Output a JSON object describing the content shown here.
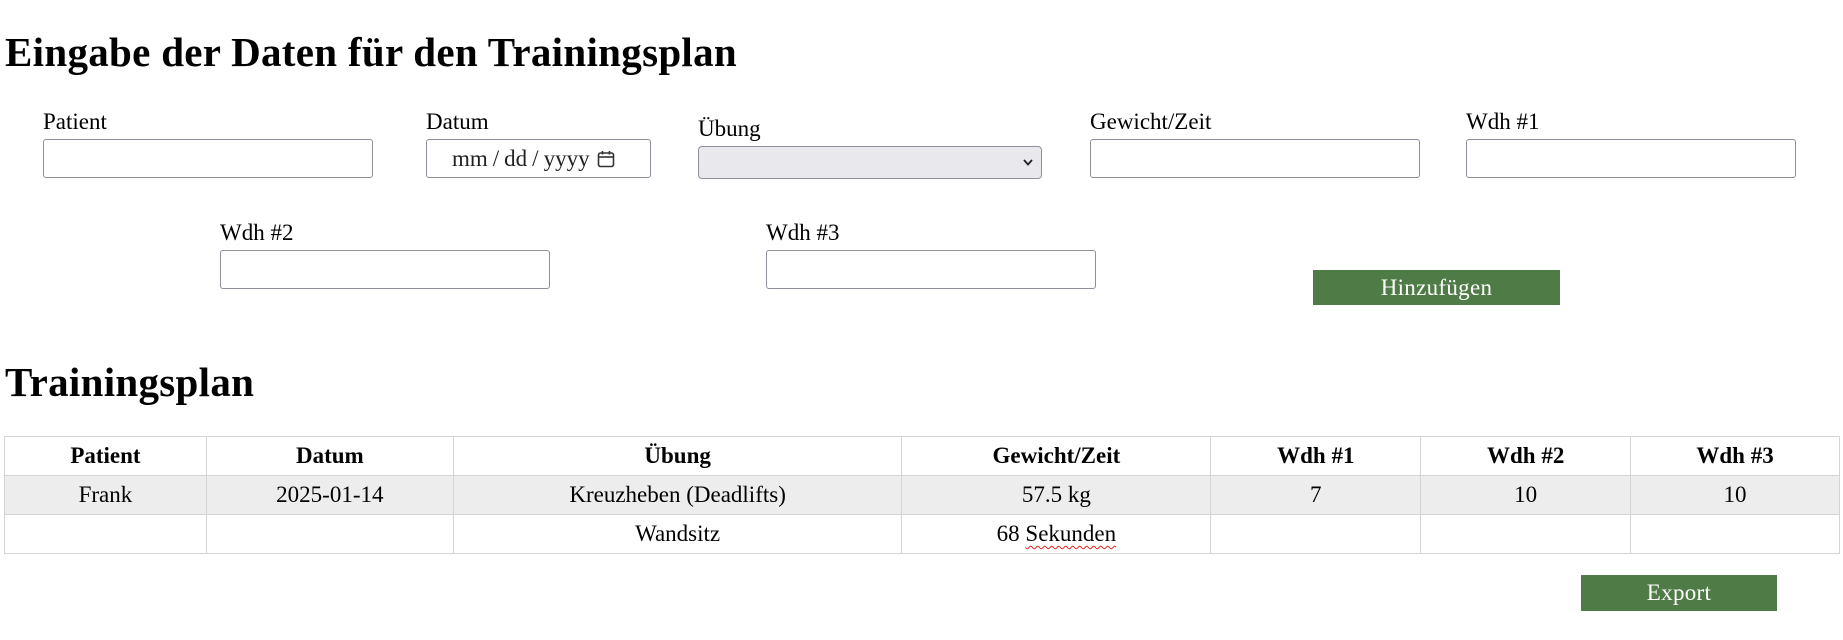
{
  "form": {
    "title": "Eingabe der Daten für den Trainingsplan",
    "patient_label": "Patient",
    "patient_value": "",
    "datum_label": "Datum",
    "datum_placeholder": {
      "month": "mm",
      "day": "dd",
      "year": "yyyy",
      "sep": "/"
    },
    "uebung_label": "Übung",
    "uebung_selected": "",
    "gewicht_label": "Gewicht/Zeit",
    "gewicht_value": "",
    "wdh1_label": "Wdh #1",
    "wdh1_value": "",
    "wdh2_label": "Wdh #2",
    "wdh2_value": "",
    "wdh3_label": "Wdh #3",
    "wdh3_value": "",
    "add_button": "Hinzufügen"
  },
  "plan": {
    "title": "Trainingsplan",
    "columns": [
      "Patient",
      "Datum",
      "Übung",
      "Gewicht/Zeit",
      "Wdh #1",
      "Wdh #2",
      "Wdh #3"
    ],
    "rows": [
      [
        "Frank",
        "2025-01-14",
        "Kreuzheben (Deadlifts)",
        "57.5 kg",
        "7",
        "10",
        "10"
      ],
      [
        "",
        "",
        "Wandsitz",
        "68 Sekunden",
        "",
        "",
        ""
      ]
    ],
    "export_button": "Export"
  },
  "colors": {
    "button_bg": "#4e7b46",
    "button_text": "#ffffff",
    "shaded_row": "#ededed",
    "select_bg": "#e9e9ed"
  },
  "icons": {
    "date_picker": "calendar-icon",
    "select_arrow": "chevron-down-icon"
  }
}
